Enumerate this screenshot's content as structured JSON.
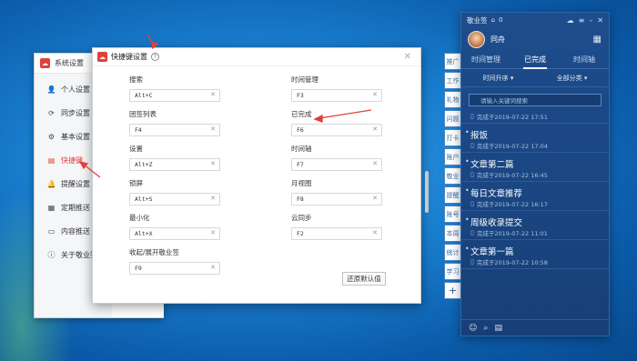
{
  "colors": {
    "accent": "#e0403a",
    "panel": "#1e4d8c",
    "desktop": "#1a7fd0"
  },
  "system_window": {
    "title": "系统设置",
    "menu": [
      {
        "label": "个人设置",
        "icon": "person-icon",
        "active": false
      },
      {
        "label": "同步设置",
        "icon": "sync-icon",
        "active": false
      },
      {
        "label": "基本设置",
        "icon": "settings-icon",
        "active": false
      },
      {
        "label": "快捷键",
        "icon": "keyboard-icon",
        "active": true
      },
      {
        "label": "提醒设置",
        "icon": "bell-icon",
        "active": false
      },
      {
        "label": "定期推送",
        "icon": "schedule-icon",
        "active": false
      },
      {
        "label": "内容推送",
        "icon": "content-icon",
        "active": false
      },
      {
        "label": "关于敬业签",
        "icon": "info-icon",
        "active": false
      }
    ]
  },
  "shortcut_dialog": {
    "title": "快捷键设置",
    "restore_label": "还原默认值",
    "shortcuts_left": [
      {
        "label": "搜索",
        "value": "Alt+C"
      },
      {
        "label": "团签列表",
        "value": "F4"
      },
      {
        "label": "设置",
        "value": "Alt+Z"
      },
      {
        "label": "锁屏",
        "value": "Alt+S"
      },
      {
        "label": "最小化",
        "value": "Alt+X"
      },
      {
        "label": "收起/展开敬业签",
        "value": "F9"
      }
    ],
    "shortcuts_right": [
      {
        "label": "时间管理",
        "value": "F3"
      },
      {
        "label": "已完成",
        "value": "F6"
      },
      {
        "label": "时间轴",
        "value": "F7"
      },
      {
        "label": "月视图",
        "value": "F8"
      },
      {
        "label": "云同步",
        "value": "F2"
      }
    ]
  },
  "note_panel": {
    "app_name": "敬业签",
    "count": "0",
    "username": "同舟",
    "tabs": [
      "时间管理",
      "已完成",
      "时间轴"
    ],
    "active_tab": "已完成",
    "filters": {
      "sort": "时间升序",
      "category": "全部分类"
    },
    "search_placeholder": "请输入关键词搜索",
    "items": [
      {
        "title": "",
        "meta": "完成于2019-07-22 17:51"
      },
      {
        "title": "报饭",
        "meta": "完成于2019-07-22 17:04"
      },
      {
        "title": "文章第二篇",
        "meta": "完成于2019-07-22 16:45"
      },
      {
        "title": "每日文章推荐",
        "meta": "完成于2019-07-22 16:17"
      },
      {
        "title": "周级收录提交",
        "meta": "完成于2019-07-22 11:01"
      },
      {
        "title": "文章第一篇",
        "meta": "完成于2019-07-22 10:58"
      }
    ],
    "side_tabs": [
      "推广",
      "工作",
      "礼物",
      "问题",
      "打卡",
      "账户",
      "敬业",
      "提醒",
      "账号",
      "本周",
      "统计",
      "学习",
      "领域",
      "数据"
    ]
  }
}
